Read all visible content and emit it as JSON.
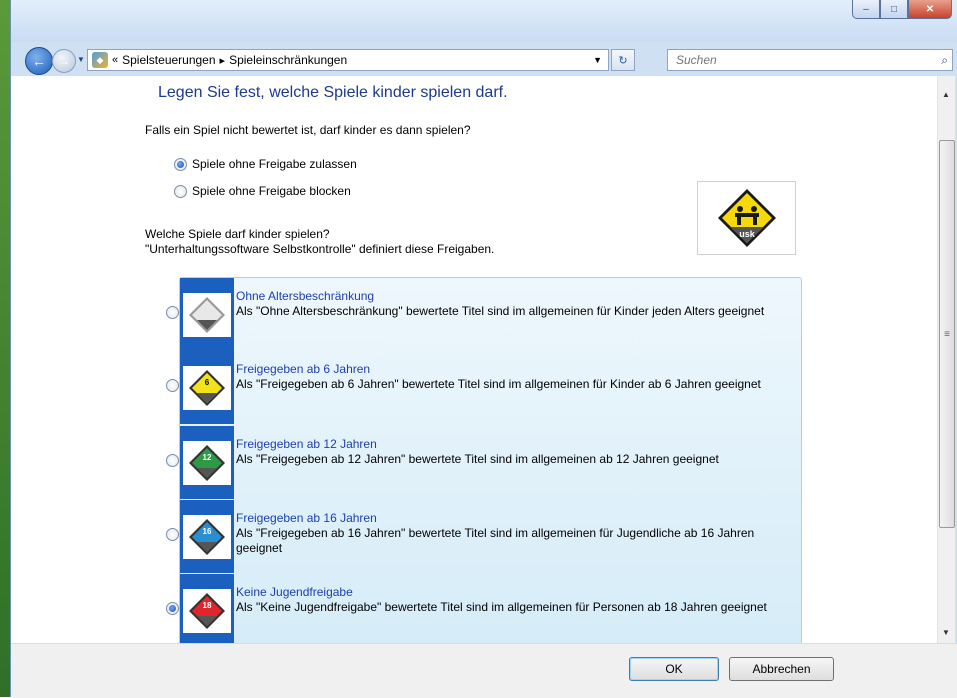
{
  "window": {
    "breadcrumb": {
      "overflow": "«",
      "items": [
        "Spielsteuerungen",
        "Spieleinschränkungen"
      ]
    },
    "search_placeholder": "Suchen",
    "caption": {
      "minimize": "–",
      "maximize": "□",
      "close": "✕"
    }
  },
  "page": {
    "heading": "Legen Sie fest, welche Spiele kinder spielen darf.",
    "unrated_question": "Falls ein Spiel nicht bewertet ist, darf kinder es dann spielen?",
    "unrated_options": [
      {
        "label": "Spiele ohne Freigabe zulassen",
        "selected": true
      },
      {
        "label": "Spiele ohne Freigabe blocken",
        "selected": false
      }
    ],
    "rating_question": "Welche Spiele darf kinder spielen?",
    "rating_note": "\"Unterhaltungssoftware Selbstkontrolle\" definiert diese Freigaben.",
    "usk_logo_text": "usk",
    "ratings": [
      {
        "title": "Ohne Altersbeschränkung",
        "desc": "Als \"Ohne Altersbeschränkung\" bewertete Titel sind im allgemeinen für Kinder jeden Alters geeignet",
        "color": "#e8e8e8",
        "badge": "",
        "selected": false
      },
      {
        "title": "Freigegeben ab 6 Jahren",
        "desc": "Als \"Freigegeben ab 6 Jahren\" bewertete Titel sind im allgemeinen für Kinder ab 6 Jahren geeignet",
        "color": "#f2e21a",
        "badge": "6",
        "selected": false
      },
      {
        "title": "Freigegeben ab 12 Jahren",
        "desc": "Als \"Freigegeben ab 12 Jahren\" bewertete Titel sind im allgemeinen ab 12 Jahren geeignet",
        "color": "#2e9a45",
        "badge": "12",
        "selected": false
      },
      {
        "title": "Freigegeben ab 16 Jahren",
        "desc": "Als \"Freigegeben ab 16 Jahren\" bewertete Titel sind im allgemeinen für Jugendliche ab 16 Jahren geeignet",
        "color": "#2a8fd0",
        "badge": "16",
        "selected": false
      },
      {
        "title": "Keine Jugendfreigabe",
        "desc": "Als \"Keine Jugendfreigabe\" bewertete Titel sind im allgemeinen für Personen ab 18 Jahren geeignet",
        "color": "#e0262a",
        "badge": "18",
        "selected": true
      }
    ]
  },
  "footer": {
    "ok": "OK",
    "cancel": "Abbrechen"
  }
}
